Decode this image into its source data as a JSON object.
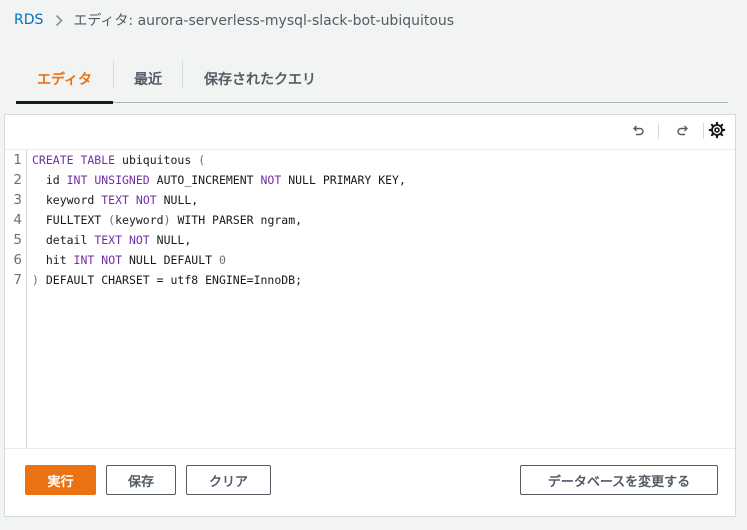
{
  "breadcrumb": {
    "root": "RDS",
    "current": "エディタ: aurora-serverless-mysql-slack-bot-ubiquitous"
  },
  "tabs": [
    {
      "label": "エディタ",
      "active": true
    },
    {
      "label": "最近",
      "active": false
    },
    {
      "label": "保存されたクエリ",
      "active": false
    }
  ],
  "toolbar": {
    "undo_icon": "undo-icon",
    "redo_icon": "redo-icon",
    "settings_icon": "gear-icon"
  },
  "editor": {
    "line_numbers": [
      "1",
      "2",
      "3",
      "4",
      "5",
      "6",
      "7"
    ],
    "lines": [
      [
        [
          "kw",
          "CREATE TABLE"
        ],
        [
          "tx",
          " ubiquitous "
        ],
        [
          "pn",
          "("
        ]
      ],
      [
        [
          "tx",
          "  id "
        ],
        [
          "kw",
          "INT UNSIGNED"
        ],
        [
          "tx",
          " AUTO_INCREMENT "
        ],
        [
          "kw",
          "NOT"
        ],
        [
          "tx",
          " NULL PRIMARY KEY,"
        ]
      ],
      [
        [
          "tx",
          "  keyword "
        ],
        [
          "kw",
          "TEXT"
        ],
        [
          "tx",
          " "
        ],
        [
          "kw",
          "NOT"
        ],
        [
          "tx",
          " NULL,"
        ]
      ],
      [
        [
          "tx",
          "  FULLTEXT "
        ],
        [
          "pn",
          "("
        ],
        [
          "tx",
          "keyword"
        ],
        [
          "pn",
          ")"
        ],
        [
          "tx",
          " WITH PARSER ngram,"
        ]
      ],
      [
        [
          "tx",
          "  detail "
        ],
        [
          "kw",
          "TEXT"
        ],
        [
          "tx",
          " "
        ],
        [
          "kw",
          "NOT"
        ],
        [
          "tx",
          " NULL,"
        ]
      ],
      [
        [
          "tx",
          "  hit "
        ],
        [
          "kw",
          "INT"
        ],
        [
          "tx",
          " "
        ],
        [
          "kw",
          "NOT"
        ],
        [
          "tx",
          " NULL DEFAULT "
        ],
        [
          "pn",
          "0"
        ]
      ],
      [
        [
          "pn",
          ")"
        ],
        [
          "tx",
          " DEFAULT CHARSET = utf8 ENGINE=InnoDB;"
        ]
      ]
    ]
  },
  "footer": {
    "run_label": "実行",
    "save_label": "保存",
    "clear_label": "クリア",
    "change_db_label": "データベースを変更する"
  },
  "colors": {
    "accent": "#ec7211",
    "link": "#0073bb",
    "keyword": "#6f2ea8"
  }
}
